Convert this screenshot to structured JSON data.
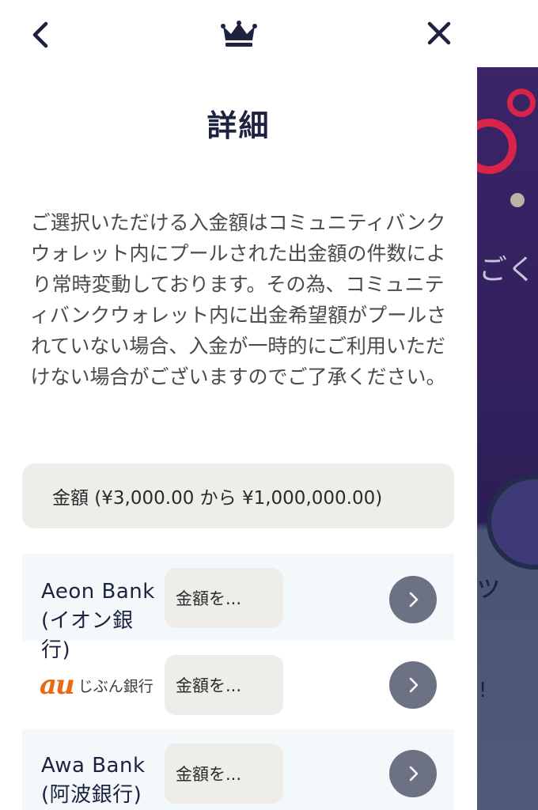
{
  "header": {
    "back_icon": "chevron-left-icon",
    "crown_icon": "crown-icon",
    "close_icon": "close-icon",
    "title": "詳細"
  },
  "description": "ご選択いただける入金額はコミュニティバンクウォレット内にプールされた出金額の件数により常時変動しております。その為、コミュニティバンクウォレット内に出金希望額がプールされていない場合、入金が一時的にご利用いただけない場合がございますのでご了承ください。",
  "amount_range": "金額 (¥3,000.00 から ¥1,000,000.00)",
  "banks": [
    {
      "name_line1": "Aeon Bank",
      "name_line2": "(イオン銀",
      "name_line3": "行)",
      "input_placeholder": "金額を..."
    },
    {
      "logo_mark": "au",
      "logo_text": "じぶん銀行",
      "input_placeholder": "金額を..."
    },
    {
      "name_line1": "Awa Bank",
      "name_line2": "(阿波銀行)",
      "input_placeholder": "金額を..."
    }
  ],
  "background": {
    "text_right_1": "ごく",
    "text_right_2": "ッ",
    "text_right_3": "!"
  },
  "colors": {
    "navy": "#1c2240",
    "field_bg": "#efedea",
    "go_button": "#6d7184",
    "au_orange": "#e96a12"
  }
}
